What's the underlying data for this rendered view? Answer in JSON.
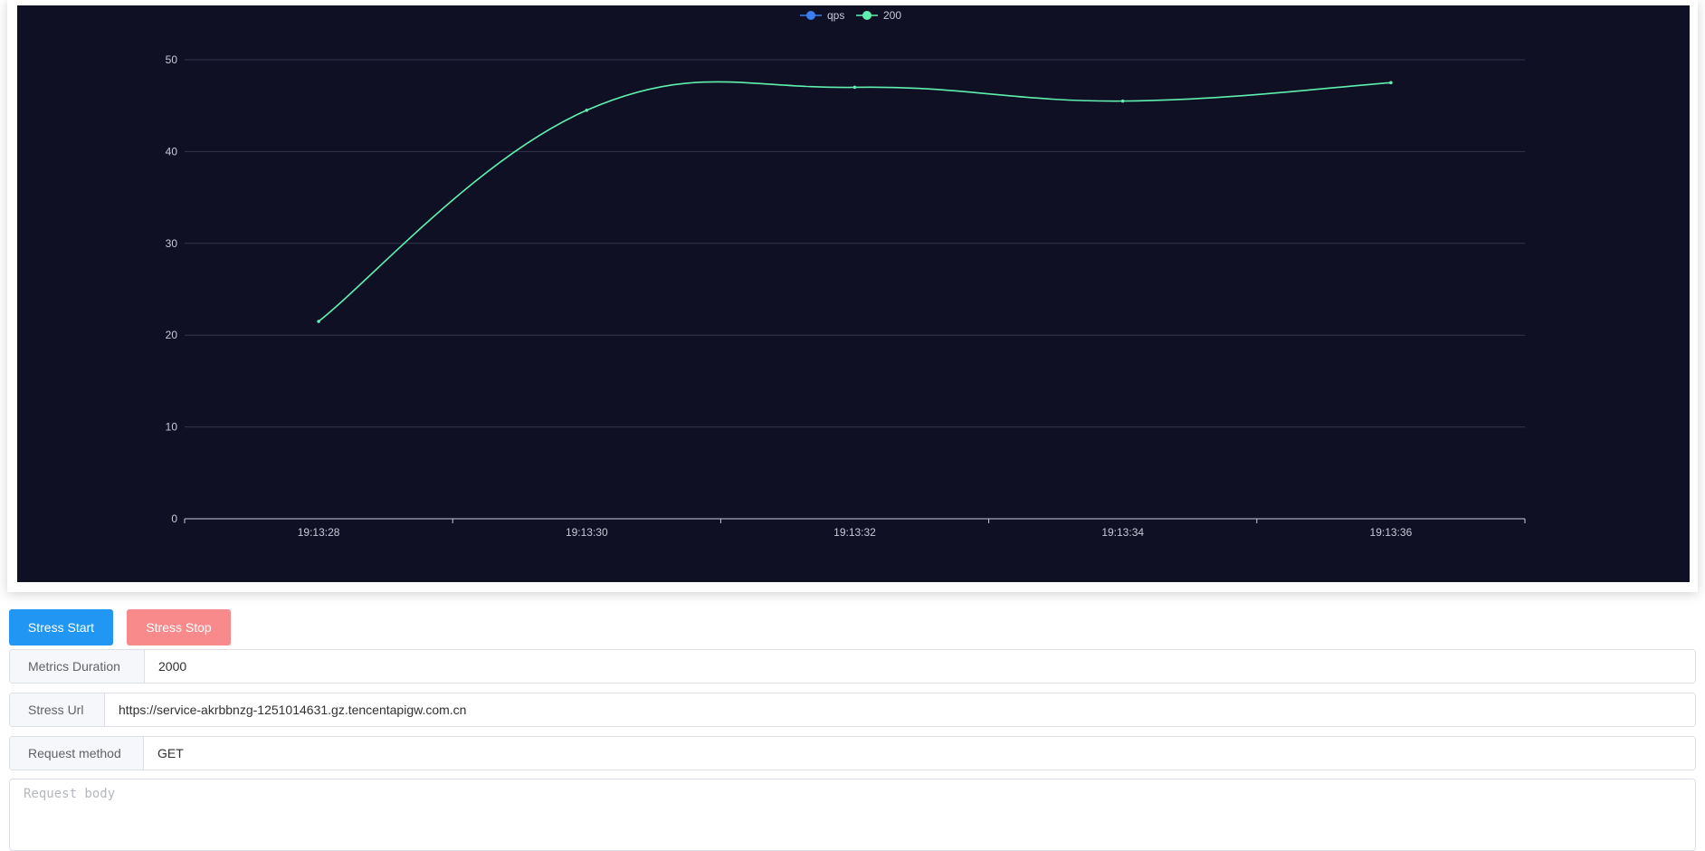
{
  "chart_data": {
    "type": "line",
    "legend": [
      {
        "name": "qps",
        "color": "#3a7ef0"
      },
      {
        "name": "200",
        "color": "#5ff0b0"
      }
    ],
    "x": [
      "19:13:28",
      "19:13:30",
      "19:13:32",
      "19:13:34",
      "19:13:36"
    ],
    "series": [
      {
        "name": "200",
        "color": "#5ff0b0",
        "values": [
          21.5,
          44.5,
          47,
          45.5,
          47.5
        ]
      }
    ],
    "ylim": [
      0,
      50
    ],
    "yticks": [
      "0",
      "10",
      "20",
      "30",
      "40",
      "50"
    ],
    "grid": true,
    "legend_position": "top-center",
    "smooth": true,
    "background": "#101025"
  },
  "controls": {
    "start_label": "Stress Start",
    "stop_label": "Stress Stop"
  },
  "form": {
    "metrics_duration": {
      "label": "Metrics Duration",
      "value": "2000"
    },
    "stress_url": {
      "label": "Stress Url",
      "value": "https://service-akrbbnzg-1251014631.gz.tencentapigw.com.cn"
    },
    "request_method": {
      "label": "Request method",
      "value": "GET"
    },
    "request_body": {
      "placeholder": "Request body",
      "value": ""
    }
  }
}
